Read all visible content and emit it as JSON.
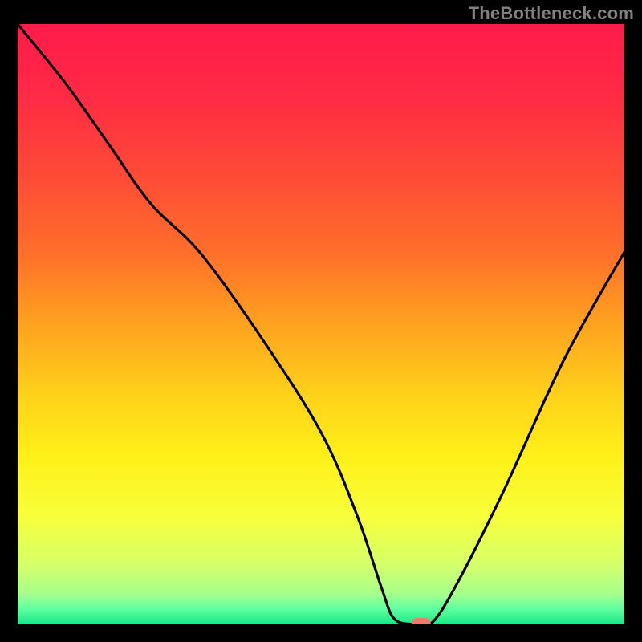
{
  "attribution": "TheBottleneck.com",
  "colors": {
    "gradient_stops": [
      {
        "offset": 0.0,
        "color": "#ff1b4b"
      },
      {
        "offset": 0.12,
        "color": "#ff2a44"
      },
      {
        "offset": 0.25,
        "color": "#ff4a37"
      },
      {
        "offset": 0.38,
        "color": "#ff6e2a"
      },
      {
        "offset": 0.5,
        "color": "#ffa21f"
      },
      {
        "offset": 0.62,
        "color": "#ffd21a"
      },
      {
        "offset": 0.72,
        "color": "#fff018"
      },
      {
        "offset": 0.82,
        "color": "#f7ff3a"
      },
      {
        "offset": 0.9,
        "color": "#d6ff6a"
      },
      {
        "offset": 0.95,
        "color": "#a4ff8c"
      },
      {
        "offset": 0.975,
        "color": "#5dffa0"
      },
      {
        "offset": 1.0,
        "color": "#17e786"
      }
    ],
    "curve": "#000000",
    "marker_fill": "#ef7b6f",
    "frame_bg": "#000000"
  },
  "chart_data": {
    "type": "line",
    "title": "",
    "xlabel": "",
    "ylabel": "",
    "xlim": [
      0,
      100
    ],
    "ylim": [
      0,
      100
    ],
    "series": [
      {
        "name": "bottleneck-curve",
        "x": [
          0,
          8,
          15,
          22,
          30,
          40,
          50,
          56,
          60,
          62,
          65,
          68,
          72,
          80,
          90,
          100
        ],
        "y": [
          100,
          90,
          80,
          70,
          62,
          48,
          32,
          18,
          6,
          1,
          0,
          0,
          6,
          22,
          44,
          62
        ]
      }
    ],
    "marker": {
      "x": 66.5,
      "y": 0
    }
  }
}
